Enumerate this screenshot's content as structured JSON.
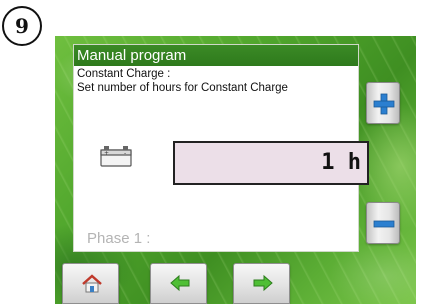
{
  "step": {
    "number": "9"
  },
  "panel": {
    "title": "Manual program",
    "subtitle_line1": "Constant Charge :",
    "subtitle_line2": "Set number of hours for Constant Charge",
    "value": "1 h",
    "phase_label": "Phase 1 :"
  },
  "icons": {
    "battery": "battery-icon",
    "plus": "plus-icon",
    "minus": "minus-icon",
    "home": "home-icon",
    "back": "arrow-left-icon",
    "next": "arrow-right-icon"
  },
  "colors": {
    "title_bar": "#2e7a1c",
    "background": "#4fa52c",
    "value_box": "#ecdfe8",
    "plus_minus": "#2b7fd0",
    "arrows": "#4fbf35"
  }
}
